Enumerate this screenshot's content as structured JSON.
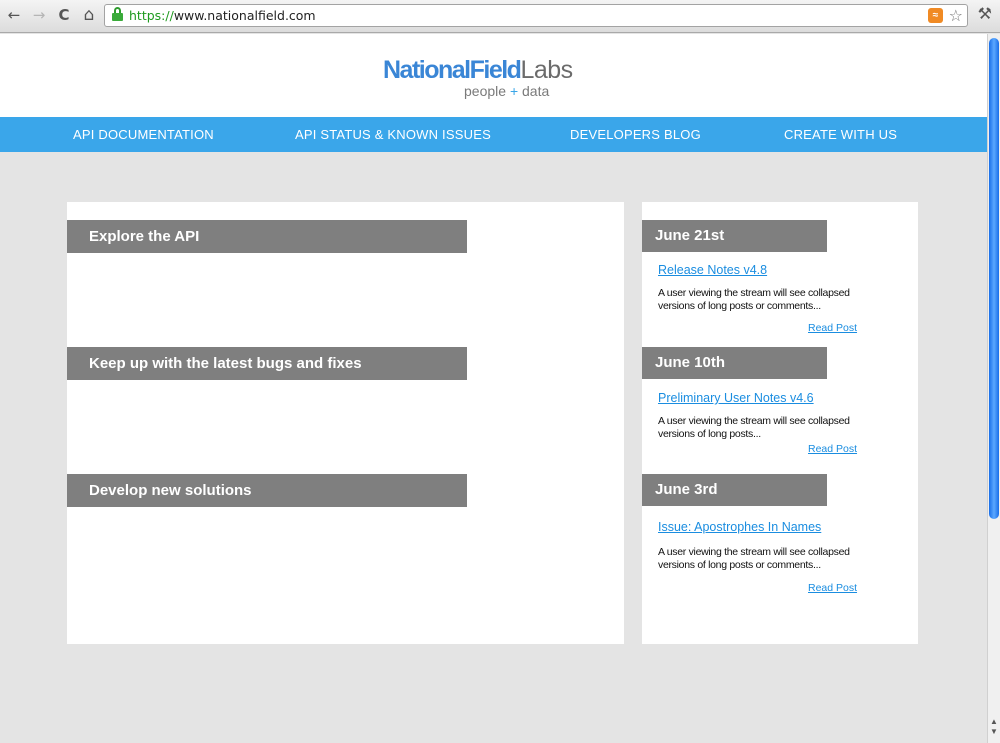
{
  "browser": {
    "back_icon": "←",
    "forward_icon": "→",
    "reload_icon": "C",
    "home_icon": "⌂",
    "url_scheme": "https://",
    "url_host": "www.nationalfield.com",
    "rss_label": "RSS",
    "star_icon": "☆",
    "wrench_icon": "🔧"
  },
  "logo": {
    "main_part1": "NationalField",
    "main_part2": "Labs",
    "sub_part1": "people ",
    "sub_plus": "+",
    "sub_part2": " data"
  },
  "nav": {
    "items": [
      {
        "label": "API DOCUMENTATION"
      },
      {
        "label": "API STATUS & KNOWN ISSUES"
      },
      {
        "label": "DEVELOPERS BLOG"
      },
      {
        "label": "CREATE WITH US"
      }
    ]
  },
  "sections": [
    {
      "title": "Explore the API"
    },
    {
      "title": "Keep up with the latest bugs and fixes"
    },
    {
      "title": "Develop new solutions"
    }
  ],
  "posts": [
    {
      "date": "June 21st",
      "title": "Release Notes v4.8",
      "excerpt": "A user viewing the stream will see collapsed versions of long posts or comments...",
      "read_label": "Read Post"
    },
    {
      "date": "June 10th",
      "title": "Preliminary User Notes v4.6",
      "excerpt": "A user viewing the stream will see collapsed versions of long posts...",
      "read_label": "Read Post"
    },
    {
      "date": "June 3rd",
      "title": "Issue: Apostrophes In Names",
      "excerpt": "A user viewing the stream will see collapsed versions of long posts or comments...",
      "read_label": "Read Post"
    }
  ],
  "colors": {
    "brand_blue": "#3aa6ea",
    "bar_gray": "#7f7f7f",
    "link_blue": "#1a8de0"
  }
}
